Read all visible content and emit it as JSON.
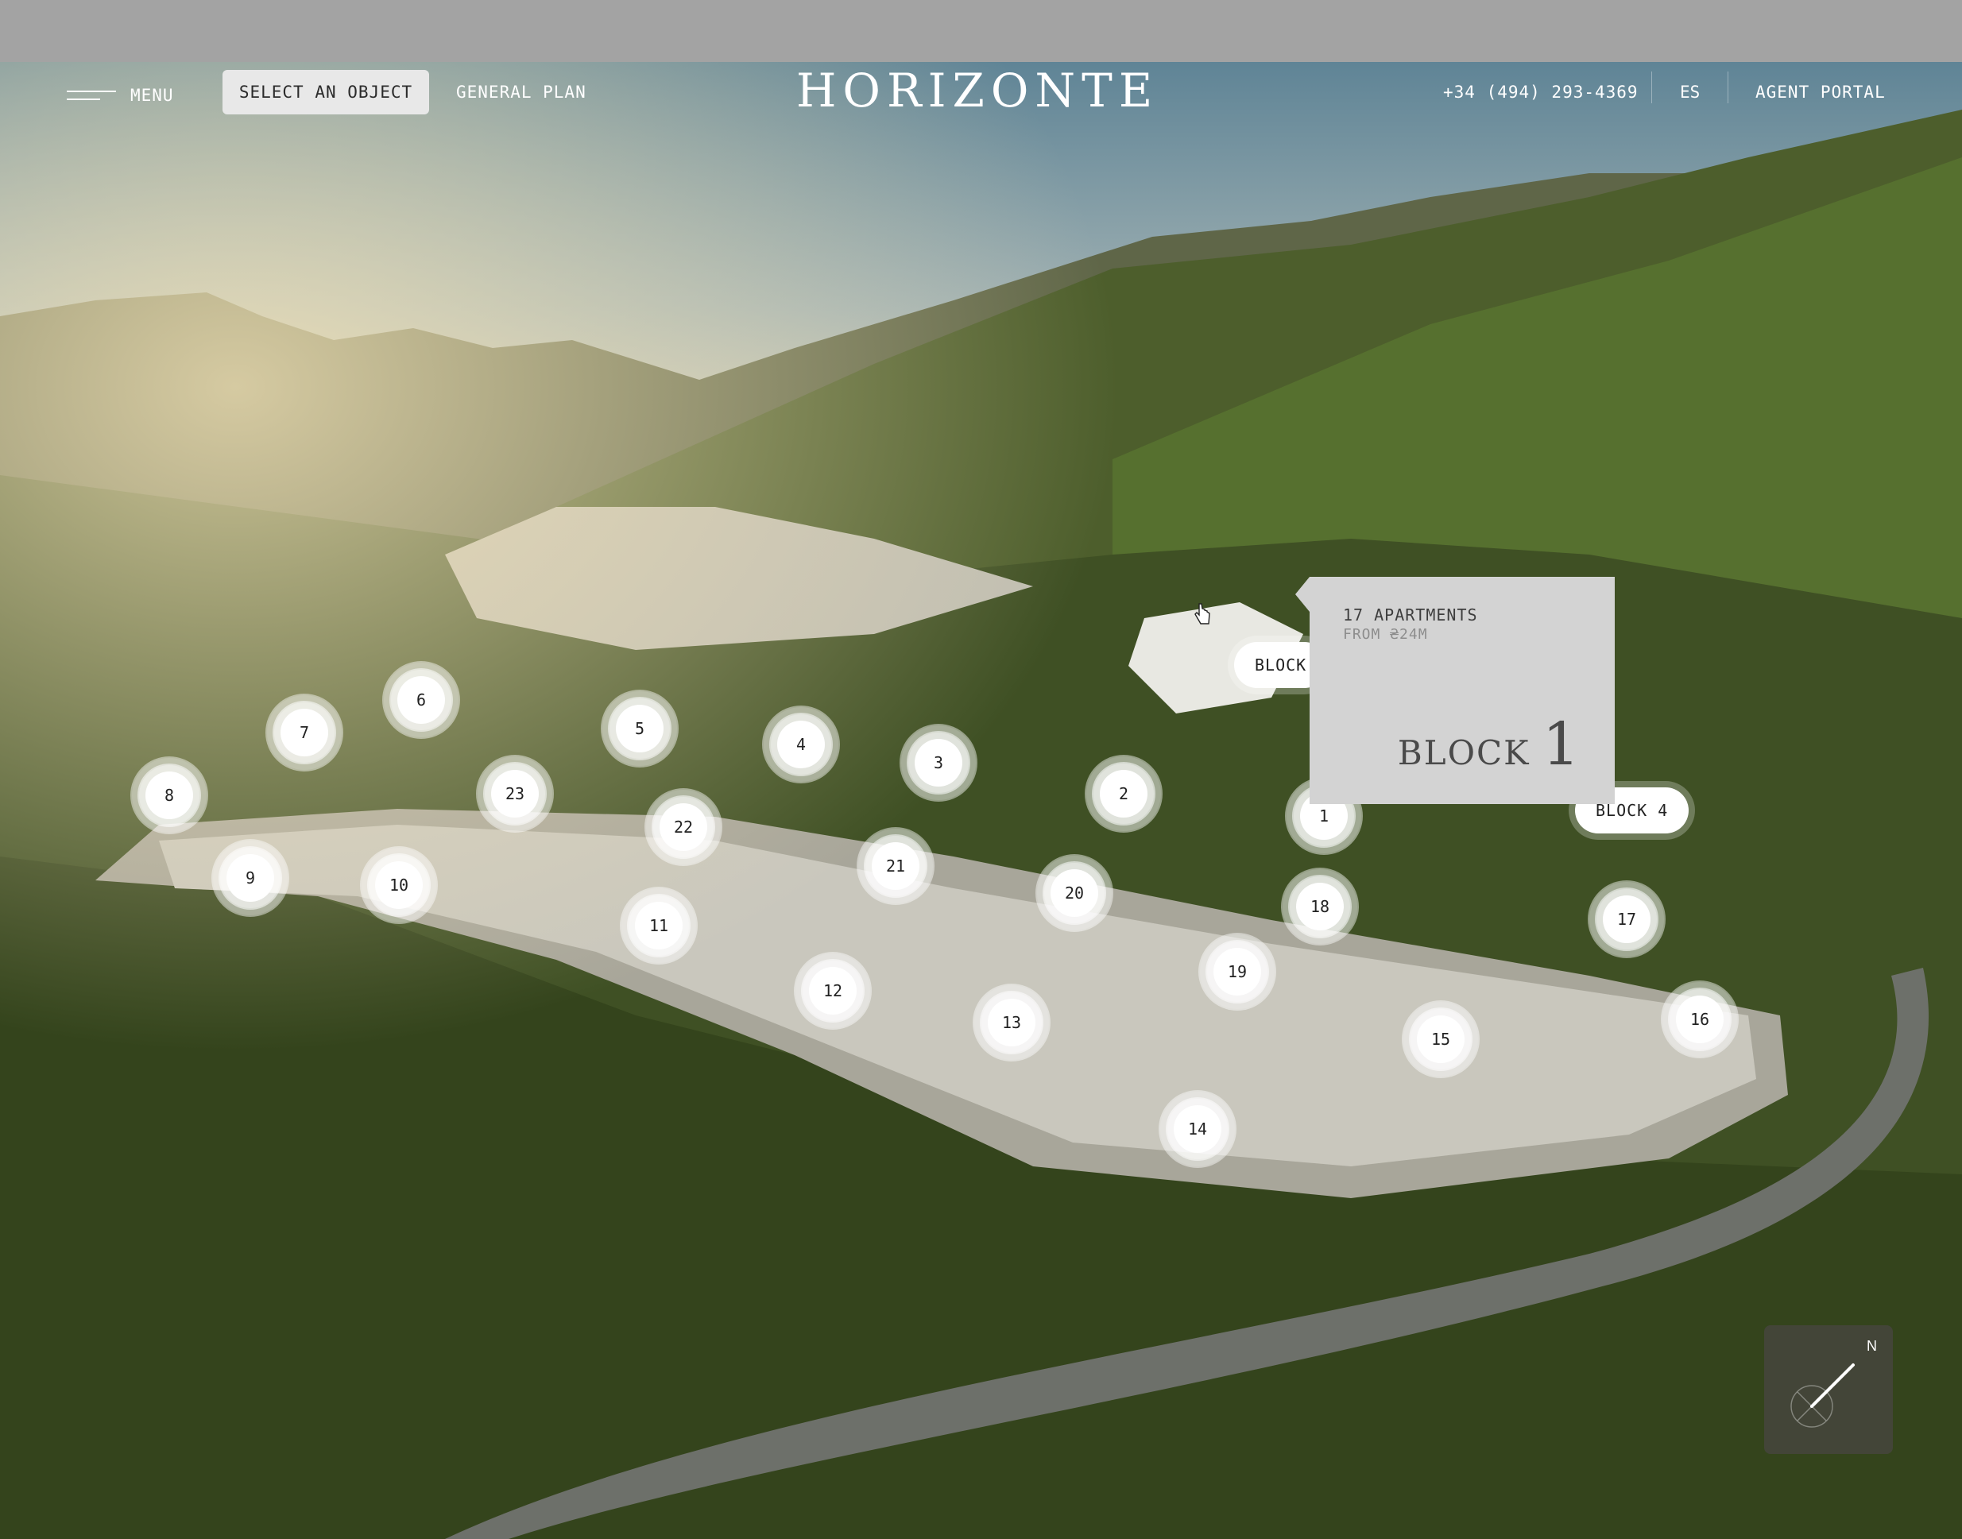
{
  "nav": {
    "menu_label": "MENU",
    "select_label": "SELECT AN OBJECT",
    "plan_label": "GENERAL PLAN",
    "logo_text": "HORIZONTE",
    "phone": "+34 (494) 293-4369",
    "lang": "ES",
    "agent_label": "AGENT PORTAL"
  },
  "markers": [
    "1",
    "2",
    "3",
    "4",
    "5",
    "6",
    "7",
    "8",
    "9",
    "10",
    "11",
    "12",
    "13",
    "14",
    "15",
    "16",
    "17",
    "18",
    "19",
    "20",
    "21",
    "22",
    "23"
  ],
  "blocks": {
    "block_a_label": "BLOCK",
    "block_b_label": "BLOCK 4"
  },
  "tooltip": {
    "apartments": "17 APARTMENTS",
    "price": "FROM ₴24M",
    "block_word": "BLOCK",
    "block_number": "1"
  },
  "compass": {
    "north": "N"
  },
  "colors": {
    "topbar": "#a3a3a3",
    "tooltip": "#d3d3d3",
    "marker": "#ffffff"
  }
}
